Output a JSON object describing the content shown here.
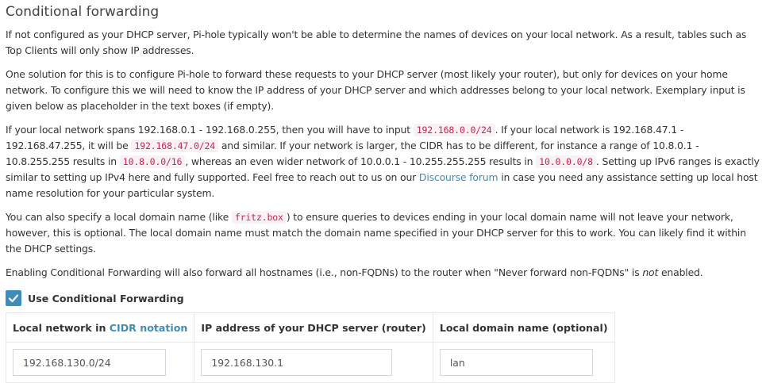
{
  "section": {
    "title": "Conditional forwarding"
  },
  "para1": {
    "text": "If not configured as your DHCP server, Pi-hole typically won't be able to determine the names of devices on your local network. As a result, tables such as Top Clients will only show IP addresses."
  },
  "para2": {
    "text": "One solution for this is to configure Pi-hole to forward these requests to your DHCP server (most likely your router), but only for devices on your home network. To configure this we will need to know the IP address of your DHCP server and which addresses belong to your local network. Exemplary input is given below as placeholder in the text boxes (if empty)."
  },
  "para3": {
    "t1": "If your local network spans 192.168.0.1 - 192.168.0.255, then you will have to input ",
    "code1": "192.168.0.0/24",
    "t2": ". If your local network is 192.168.47.1 - 192.168.47.255, it will be ",
    "code2": "192.168.47.0/24",
    "t3": " and similar. If your network is larger, the CIDR has to be different, for instance a range of 10.8.0.1 - 10.8.255.255 results in ",
    "code3": "10.8.0.0/16",
    "t4": ", whereas an even wider network of 10.0.0.1 - 10.255.255.255 results in ",
    "code4": "10.0.0.0/8",
    "t5": ". Setting up IPv6 ranges is exactly similar to setting up IPv4 here and fully supported. Feel free to reach out to us on our ",
    "link": "Discourse forum",
    "t6": " in case you need any assistance setting up local host name resolution for your particular system."
  },
  "para4": {
    "t1": "You can also specify a local domain name (like ",
    "code": "fritz.box",
    "t2": ") to ensure queries to devices ending in your local domain name will not leave your network, however, this is optional. The local domain name must match the domain name specified in your DHCP server for this to work. You can likely find it within the DHCP settings."
  },
  "para5": {
    "t1": "Enabling Conditional Forwarding will also forward all hostnames (i.e., non-FQDNs) to the router when \"Never forward non-FQDNs\" is ",
    "em": "not",
    "t2": " enabled."
  },
  "checkbox": {
    "label": "Use Conditional Forwarding",
    "checked": true
  },
  "table": {
    "col1_prefix": "Local network in ",
    "col1_link": "CIDR notation",
    "col2": "IP address of your DHCP server (router)",
    "col3": "Local domain name (optional)",
    "network_value": "192.168.130.0/24",
    "dhcp_value": "192.168.130.1",
    "domain_value": "lan"
  },
  "colors": {
    "accent": "#3c8dbc",
    "code": "#c7254e"
  }
}
